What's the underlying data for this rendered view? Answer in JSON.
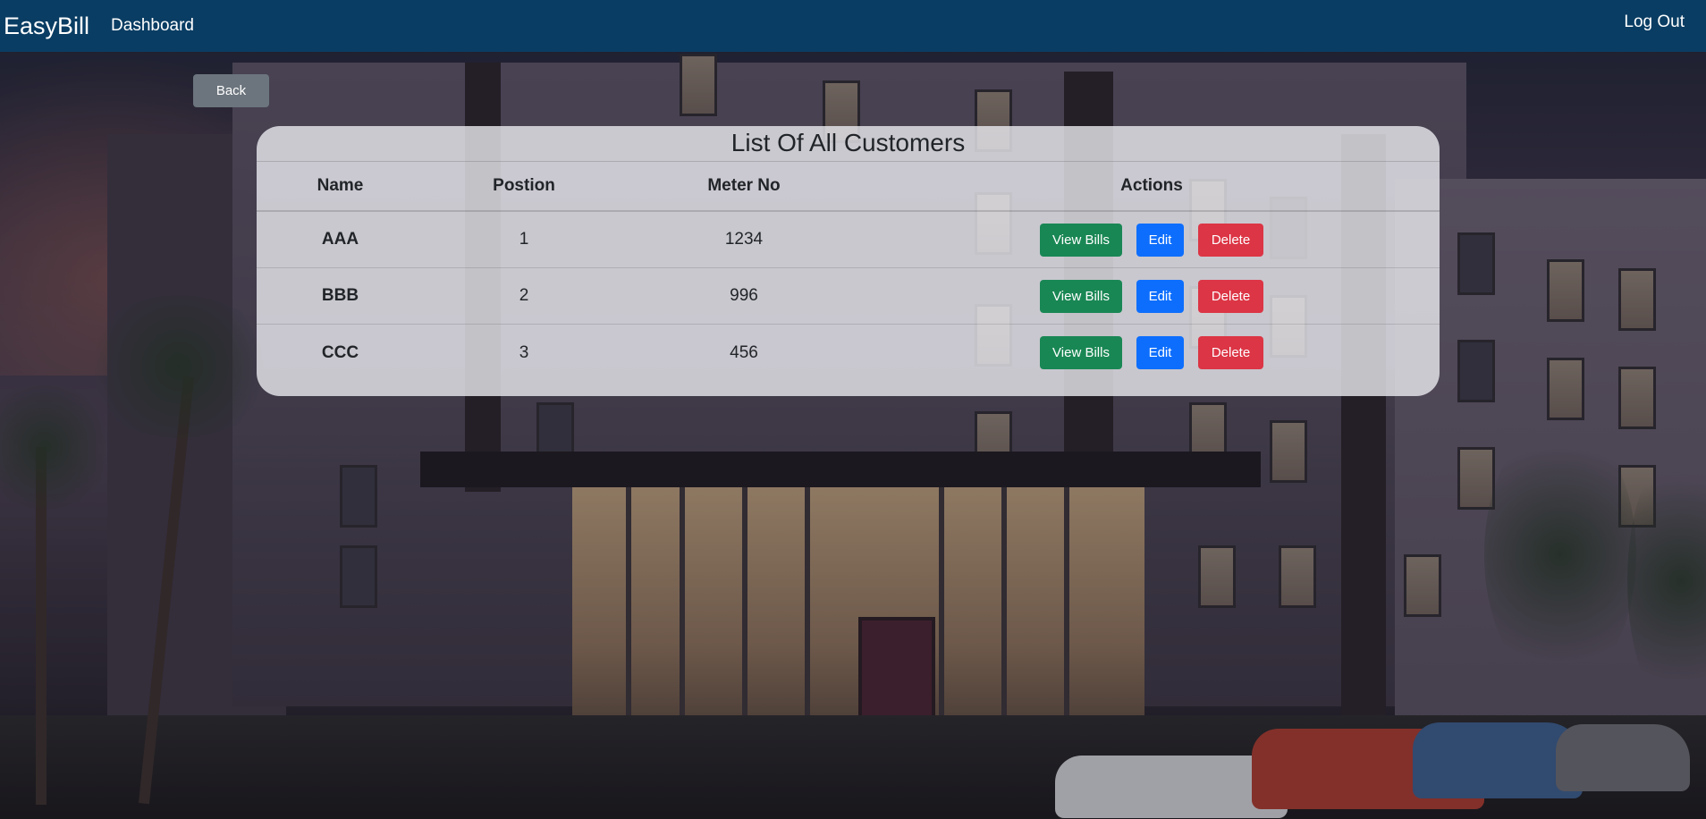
{
  "navbar": {
    "brand": "EasyBill",
    "links": [
      "Dashboard"
    ],
    "logout": "Log Out"
  },
  "back_button": "Back",
  "customers": {
    "title": "List Of All Customers",
    "columns": [
      "Name",
      "Postion",
      "Meter No",
      "Actions"
    ],
    "rows": [
      {
        "name": "AAA",
        "position": "1",
        "meter_no": "1234"
      },
      {
        "name": "BBB",
        "position": "2",
        "meter_no": "996"
      },
      {
        "name": "CCC",
        "position": "3",
        "meter_no": "456"
      }
    ],
    "actions": {
      "view_bills": "View Bills",
      "edit": "Edit",
      "delete": "Delete"
    }
  },
  "colors": {
    "navbar": "#0a3d63",
    "back_button": "#6c757d",
    "view_button": "#198754",
    "edit_button": "#0d6efd",
    "delete_button": "#dc3545"
  }
}
